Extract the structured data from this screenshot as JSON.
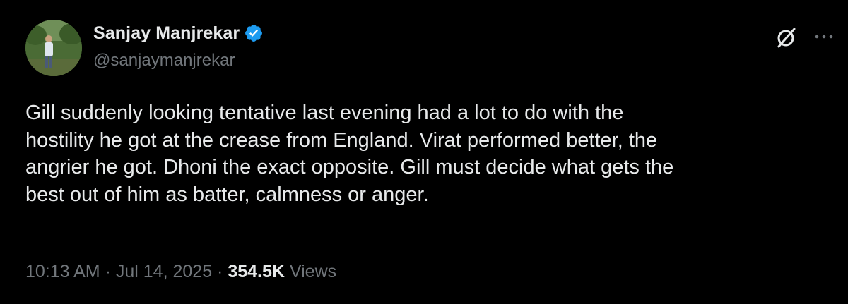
{
  "author": {
    "display_name": "Sanjay Manjrekar",
    "handle": "@sanjaymanjrekar",
    "verified": true,
    "verified_color": "#1d9bf0"
  },
  "header_actions": {
    "grok_icon": "grok-slashed-circle-icon",
    "more_icon": "more-horizontal-icon"
  },
  "tweet": {
    "text_lines": [
      "Gill suddenly looking tentative last evening had a lot to do with the",
      "hostility he got at the crease from England. Virat performed better, the",
      "angrier he got. Dhoni the exact opposite. Gill must decide what gets the",
      "best out of him as batter, calmness or anger."
    ]
  },
  "meta": {
    "time": "10:13 AM",
    "separator": "·",
    "date": "Jul 14, 2025",
    "views_count": "354.5K",
    "views_label": "Views"
  },
  "colors": {
    "background": "#000000",
    "primary_text": "#e7e9ea",
    "secondary_text": "#71767b"
  }
}
